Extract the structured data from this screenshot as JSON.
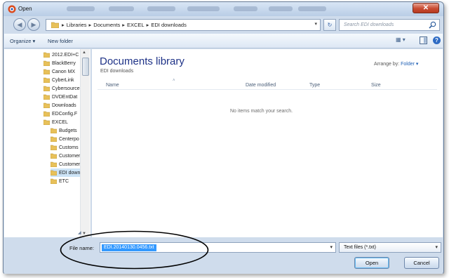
{
  "window": {
    "title": "Open",
    "close_label": "✕"
  },
  "address": {
    "crumbs": [
      "Libraries",
      "Documents",
      "EXCEL",
      "EDI downloads"
    ],
    "search_placeholder": "Search EDI downloads"
  },
  "toolbar": {
    "organize_label": "Organize ▾",
    "new_folder_label": "New folder"
  },
  "nav_tree": {
    "items": [
      {
        "label": "2012.EDI+C"
      },
      {
        "label": "BlackBerry"
      },
      {
        "label": "Canon MX"
      },
      {
        "label": "CyberLink"
      },
      {
        "label": "Cybersource"
      },
      {
        "label": "DVDEntDat"
      },
      {
        "label": "Downloads"
      },
      {
        "label": "EDConfig.F"
      },
      {
        "label": "EXCEL"
      },
      {
        "label": "Budgets"
      },
      {
        "label": "Centerpo"
      },
      {
        "label": "Customs"
      },
      {
        "label": "Customer"
      },
      {
        "label": "Customer"
      },
      {
        "label": "EDI downl"
      },
      {
        "label": "ETC"
      }
    ]
  },
  "library": {
    "title": "Documents library",
    "subtitle": "EDI downloads",
    "arrange_label": "Arrange by:",
    "arrange_value": "Folder ▾"
  },
  "columns": {
    "name": "Name",
    "date_modified": "Date modified",
    "type": "Type",
    "size": "Size"
  },
  "empty_message": "No items match your search.",
  "bottom": {
    "file_name_label": "File name:",
    "file_name_value": "EDI.20140130.0456.txt",
    "file_type_value": "Text files (*.txt)",
    "open_label": "Open",
    "cancel_label": "Cancel"
  },
  "colors": {
    "selection": "#3399ff",
    "library_title": "#1e3287",
    "annotation": "#000000"
  }
}
